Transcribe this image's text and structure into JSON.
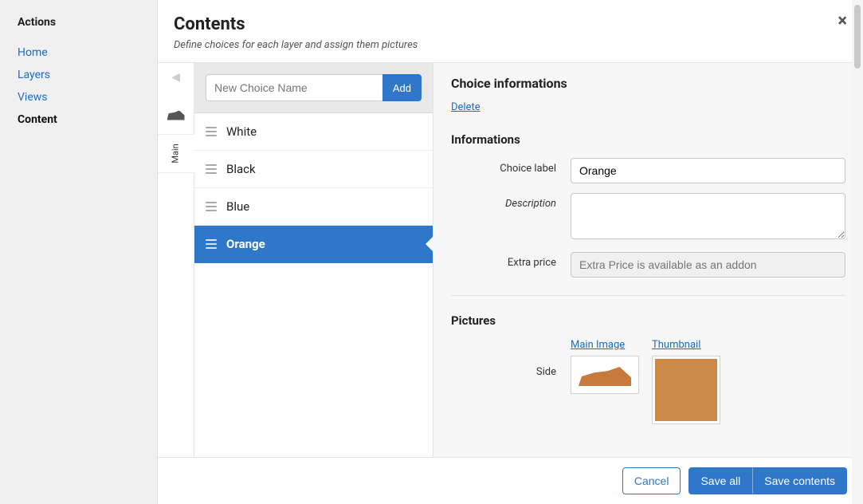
{
  "sidebar": {
    "heading": "Actions",
    "items": [
      {
        "label": "Home",
        "active": false
      },
      {
        "label": "Layers",
        "active": false
      },
      {
        "label": "Views",
        "active": false
      },
      {
        "label": "Content",
        "active": true
      }
    ]
  },
  "header": {
    "title": "Contents",
    "subtitle": "Define choices for each layer and assign them pictures"
  },
  "layer_tabs": {
    "back_icon": "caret-left",
    "tabs": [
      {
        "id": "layer-shoe",
        "icon": "shoe"
      },
      {
        "id": "layer-main",
        "label": "Main",
        "active": true
      }
    ]
  },
  "new_choice": {
    "placeholder": "New Choice Name",
    "button": "Add"
  },
  "choices": [
    {
      "label": "White",
      "active": false
    },
    {
      "label": "Black",
      "active": false
    },
    {
      "label": "Blue",
      "active": false
    },
    {
      "label": "Orange",
      "active": true
    }
  ],
  "details": {
    "section_title": "Choice informations",
    "delete": "Delete",
    "info_heading": "Informations",
    "fields": {
      "choice_label_label": "Choice label",
      "choice_label_value": "Orange",
      "description_label": "Description",
      "description_value": "",
      "extra_price_label": "Extra price",
      "extra_price_placeholder": "Extra Price is available as an addon"
    },
    "pictures": {
      "heading": "Pictures",
      "side_label": "Side",
      "main_image_label": "Main Image",
      "thumbnail_label": "Thumbnail",
      "swatch_color": "#cc8a49",
      "shoe_color": "#c77a3b"
    }
  },
  "footer": {
    "cancel": "Cancel",
    "save_all": "Save all",
    "save_contents": "Save contents"
  }
}
